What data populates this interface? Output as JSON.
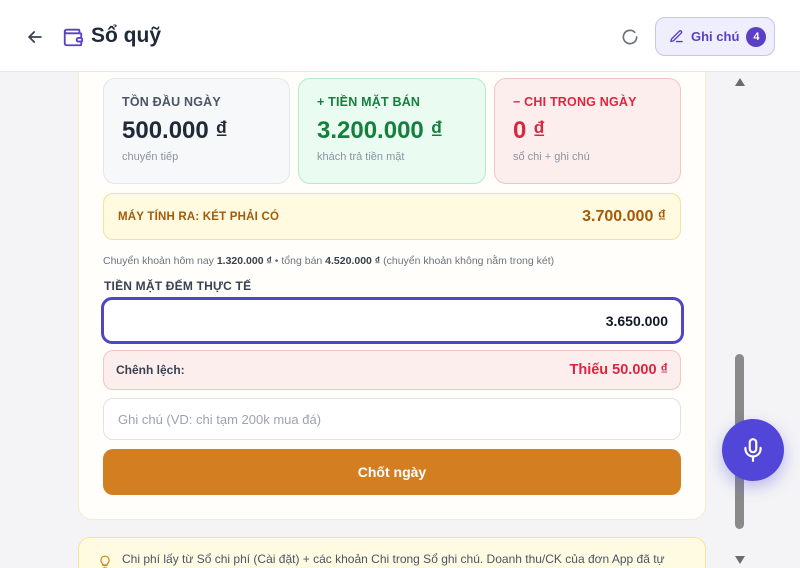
{
  "header": {
    "title": "Sổ quỹ",
    "note_button_label": "Ghi chú",
    "note_count": "4"
  },
  "stats": [
    {
      "label": "TỒN ĐẦU NGÀY",
      "value": "500.000 ₫",
      "sub": "chuyển tiếp"
    },
    {
      "label": "+ TIỀN MẶT BÁN",
      "value": "3.200.000 ₫",
      "sub": "khách trả tiền mặt"
    },
    {
      "label": "− CHI TRONG NGÀY",
      "value": "0 ₫",
      "sub": "sổ chi + ghi chú"
    }
  ],
  "expected": {
    "label": "MÁY TÍNH RA: KÉT PHẢI CÓ",
    "value": "3.700.000 ₫"
  },
  "transfer_note": {
    "prefix": "Chuyển khoản hôm nay ",
    "transfer_amount": "1.320.000 ₫",
    "middle": " • tổng bán ",
    "total_sales": "4.520.000 ₫",
    "suffix": " (chuyển khoản không nằm trong két)"
  },
  "counted": {
    "label": "TIỀN MẶT ĐẾM THỰC TẾ",
    "value": "3.650.000"
  },
  "difference": {
    "label": "Chênh lệch:",
    "value": "Thiếu 50.000 ₫"
  },
  "note_input": {
    "placeholder": "Ghi chú (VD: chi tạm 200k mua đá)"
  },
  "close_button_label": "Chốt ngày",
  "info_text": "Chi phí lấy từ Sổ chi phí (Cài đặt) + các khoản Chi trong Sổ ghi chú. Doanh thu/CK của đơn App đã tự",
  "colors": {
    "accent": "#5146d8",
    "primary_button": "#d47e22",
    "positive": "#15803d",
    "negative": "#dc2640"
  },
  "icons": {
    "back": "arrow-left-icon",
    "title": "wallet-icon",
    "refresh": "refresh-icon",
    "note": "pencil-icon",
    "mic": "microphone-icon",
    "info": "lightbulb-icon"
  }
}
